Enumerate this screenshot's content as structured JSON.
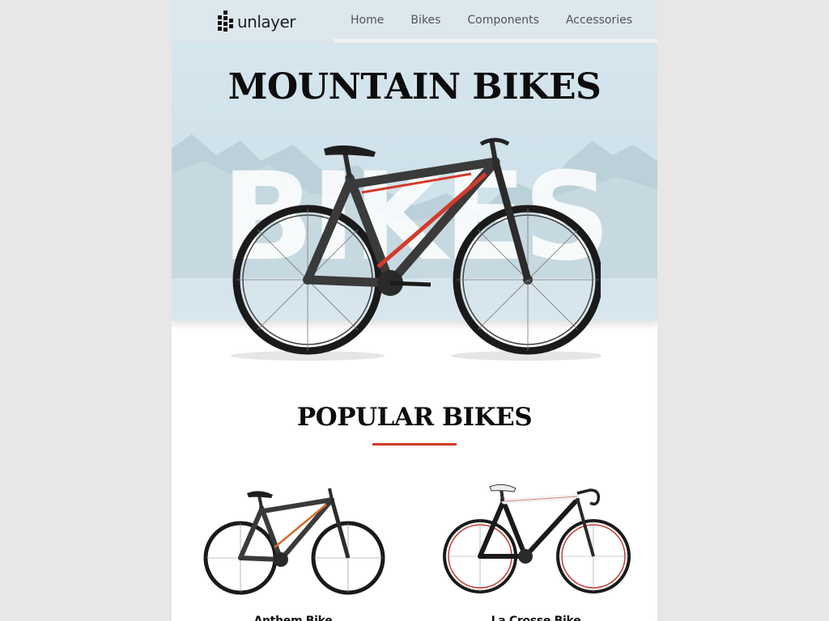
{
  "brand": {
    "name": "unlayer",
    "logo_icon": "unlayer-logo-icon"
  },
  "nav": {
    "items": [
      {
        "label": "Home"
      },
      {
        "label": "Bikes"
      },
      {
        "label": "Components"
      },
      {
        "label": "Accessories"
      }
    ]
  },
  "hero": {
    "title": "MOUNTAIN BIKES",
    "background_word": "BIKES"
  },
  "popular": {
    "title": "POPULAR BIKES",
    "accent_color": "#d43a2b",
    "products": [
      {
        "name": "Anthem Bike"
      },
      {
        "name": "La Crosse Bike"
      }
    ]
  },
  "colors": {
    "page_background": "#e7e7e7",
    "header_background": "#dce8ee",
    "hero_background": "#d3e3eb",
    "accent": "#d43a2b"
  }
}
